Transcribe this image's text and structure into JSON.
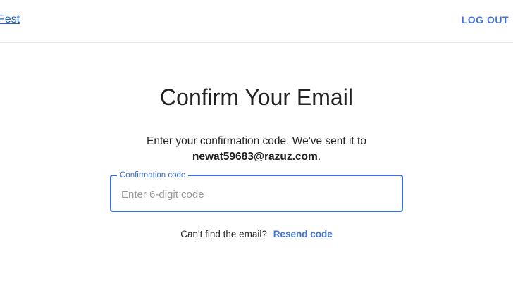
{
  "header": {
    "brand_text": "Fest",
    "logout_label": "LOG OUT"
  },
  "main": {
    "title": "Confirm Your Email",
    "message_prefix": "Enter your confirmation code. We've sent it to",
    "email": "newat59683@razuz.com",
    "message_suffix": ".",
    "code_field": {
      "label": "Confirmation code",
      "placeholder": "Enter 6-digit code",
      "value": ""
    },
    "resend_prompt": "Can't find the email?",
    "resend_link": "Resend code"
  },
  "colors": {
    "accent": "#3b6fd4",
    "link": "#1a5fd0",
    "divider": "#e6e6e6"
  }
}
